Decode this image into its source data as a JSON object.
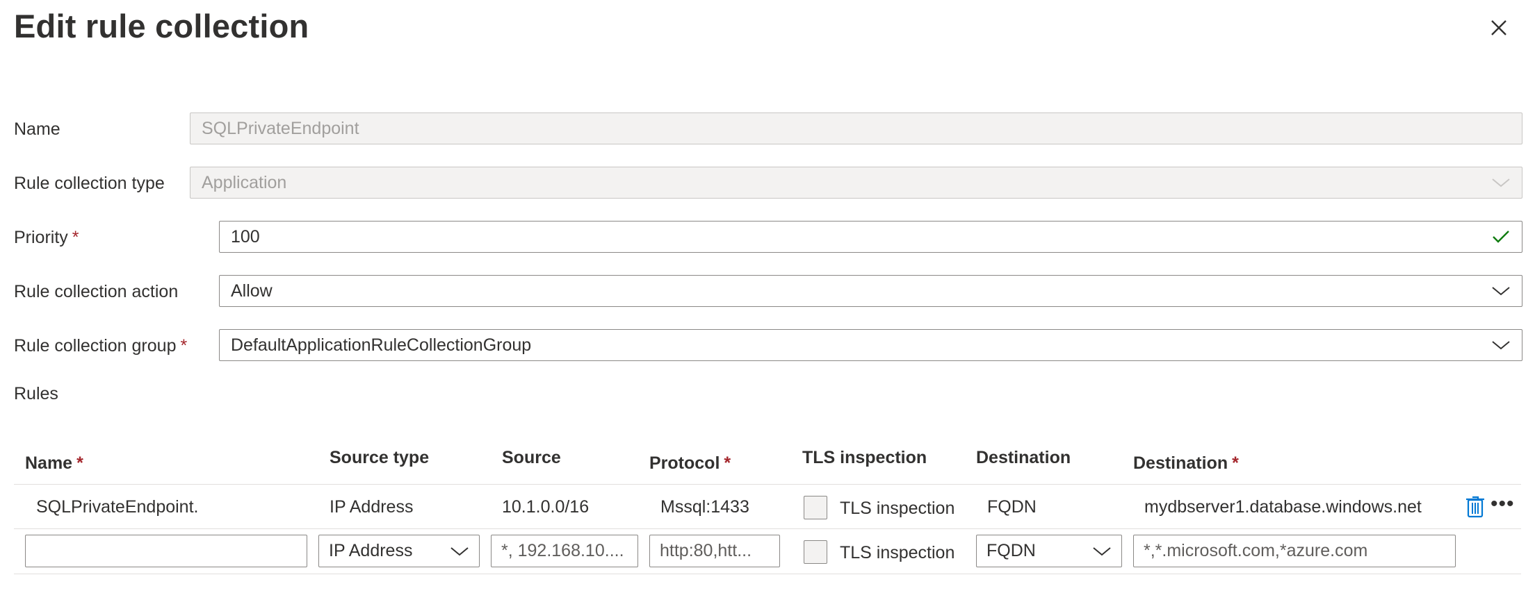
{
  "panel": {
    "title": "Edit rule collection",
    "close_icon": "close-icon"
  },
  "form": {
    "name": {
      "label": "Name",
      "value": "SQLPrivateEndpoint"
    },
    "rule_collection_type": {
      "label": "Rule collection type",
      "value": "Application"
    },
    "priority": {
      "label": "Priority",
      "required": "*",
      "value": "100"
    },
    "rule_collection_action": {
      "label": "Rule collection action",
      "value": "Allow"
    },
    "rule_collection_group": {
      "label": "Rule collection group",
      "required": "*",
      "value": "DefaultApplicationRuleCollectionGroup"
    }
  },
  "rules": {
    "label": "Rules",
    "columns": [
      {
        "label": "Name",
        "required": "*"
      },
      {
        "label": "Source type"
      },
      {
        "label": "Source"
      },
      {
        "label": "Protocol",
        "required": "*"
      },
      {
        "label": "TLS inspection"
      },
      {
        "label": "Destination"
      },
      {
        "label": "Destination",
        "required": "*"
      }
    ],
    "row": {
      "name": "SQLPrivateEndpoint.",
      "source_type": "IP Address",
      "source": "10.1.0.0/16",
      "protocol": "Mssql:1433",
      "tls_label": "TLS inspection",
      "destination_type": "FQDN",
      "destination": "mydbserver1.database.windows.net",
      "more": "•••"
    },
    "new_row": {
      "name_value": "",
      "source_type": "IP Address",
      "source_placeholder": "*, 192.168.10....",
      "protocol_placeholder": "http:80,htt...",
      "tls_label": "TLS inspection",
      "destination_type": "FQDN",
      "destination_placeholder": "*,*.microsoft.com,*azure.com"
    }
  },
  "colors": {
    "required": "#a4262c",
    "valid_check": "#107c10",
    "trash": "#0078d4",
    "disabled_bg": "#f3f2f1"
  }
}
